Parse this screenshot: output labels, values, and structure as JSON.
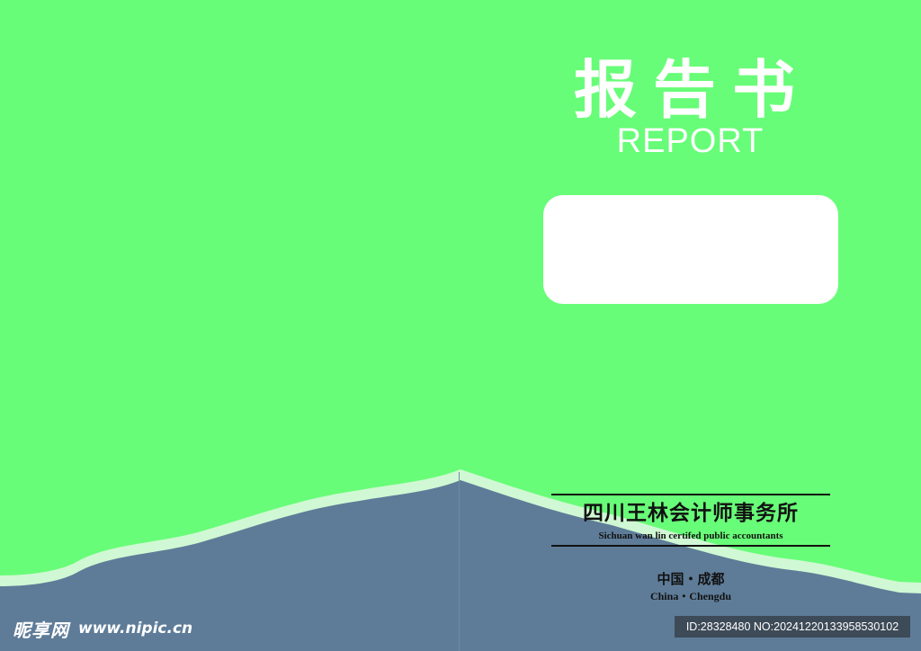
{
  "cover": {
    "title_cn": "报告书",
    "title_en": "REPORT",
    "background_color": "#68fd78",
    "band_color": "#5e7c98",
    "edge_color": "#d0f8d4"
  },
  "firm": {
    "name_cn": "四川王林会计师事务所",
    "name_en": "Sichuan wan lin certifed public accountants",
    "location_cn": "中国・成都",
    "location_en": "China・Chengdu"
  },
  "watermark": {
    "logo": "昵享网",
    "url": "www.nipic.cn",
    "id_text": "ID:28328480 NO:20241220133958530102"
  }
}
